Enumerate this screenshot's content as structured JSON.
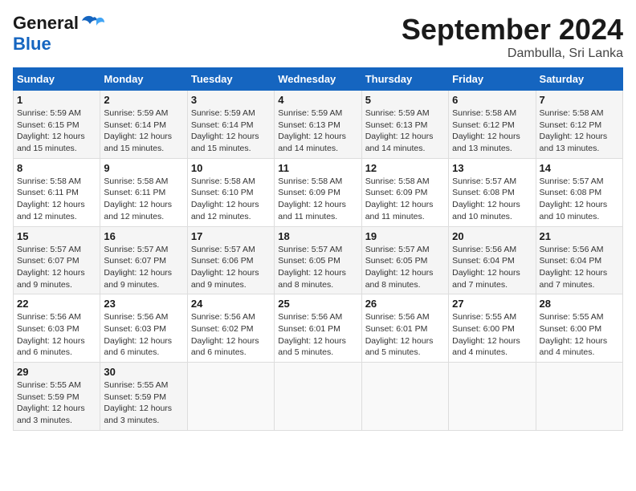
{
  "header": {
    "logo_line1": "General",
    "logo_line2": "Blue",
    "month_title": "September 2024",
    "location": "Dambulla, Sri Lanka"
  },
  "weekdays": [
    "Sunday",
    "Monday",
    "Tuesday",
    "Wednesday",
    "Thursday",
    "Friday",
    "Saturday"
  ],
  "weeks": [
    [
      {
        "day": 1,
        "sunrise": "5:59 AM",
        "sunset": "6:15 PM",
        "daylight": "12 hours and 15 minutes."
      },
      {
        "day": 2,
        "sunrise": "5:59 AM",
        "sunset": "6:14 PM",
        "daylight": "12 hours and 15 minutes."
      },
      {
        "day": 3,
        "sunrise": "5:59 AM",
        "sunset": "6:14 PM",
        "daylight": "12 hours and 15 minutes."
      },
      {
        "day": 4,
        "sunrise": "5:59 AM",
        "sunset": "6:13 PM",
        "daylight": "12 hours and 14 minutes."
      },
      {
        "day": 5,
        "sunrise": "5:59 AM",
        "sunset": "6:13 PM",
        "daylight": "12 hours and 14 minutes."
      },
      {
        "day": 6,
        "sunrise": "5:58 AM",
        "sunset": "6:12 PM",
        "daylight": "12 hours and 13 minutes."
      },
      {
        "day": 7,
        "sunrise": "5:58 AM",
        "sunset": "6:12 PM",
        "daylight": "12 hours and 13 minutes."
      }
    ],
    [
      {
        "day": 8,
        "sunrise": "5:58 AM",
        "sunset": "6:11 PM",
        "daylight": "12 hours and 12 minutes."
      },
      {
        "day": 9,
        "sunrise": "5:58 AM",
        "sunset": "6:11 PM",
        "daylight": "12 hours and 12 minutes."
      },
      {
        "day": 10,
        "sunrise": "5:58 AM",
        "sunset": "6:10 PM",
        "daylight": "12 hours and 12 minutes."
      },
      {
        "day": 11,
        "sunrise": "5:58 AM",
        "sunset": "6:09 PM",
        "daylight": "12 hours and 11 minutes."
      },
      {
        "day": 12,
        "sunrise": "5:58 AM",
        "sunset": "6:09 PM",
        "daylight": "12 hours and 11 minutes."
      },
      {
        "day": 13,
        "sunrise": "5:57 AM",
        "sunset": "6:08 PM",
        "daylight": "12 hours and 10 minutes."
      },
      {
        "day": 14,
        "sunrise": "5:57 AM",
        "sunset": "6:08 PM",
        "daylight": "12 hours and 10 minutes."
      }
    ],
    [
      {
        "day": 15,
        "sunrise": "5:57 AM",
        "sunset": "6:07 PM",
        "daylight": "12 hours and 9 minutes."
      },
      {
        "day": 16,
        "sunrise": "5:57 AM",
        "sunset": "6:07 PM",
        "daylight": "12 hours and 9 minutes."
      },
      {
        "day": 17,
        "sunrise": "5:57 AM",
        "sunset": "6:06 PM",
        "daylight": "12 hours and 9 minutes."
      },
      {
        "day": 18,
        "sunrise": "5:57 AM",
        "sunset": "6:05 PM",
        "daylight": "12 hours and 8 minutes."
      },
      {
        "day": 19,
        "sunrise": "5:57 AM",
        "sunset": "6:05 PM",
        "daylight": "12 hours and 8 minutes."
      },
      {
        "day": 20,
        "sunrise": "5:56 AM",
        "sunset": "6:04 PM",
        "daylight": "12 hours and 7 minutes."
      },
      {
        "day": 21,
        "sunrise": "5:56 AM",
        "sunset": "6:04 PM",
        "daylight": "12 hours and 7 minutes."
      }
    ],
    [
      {
        "day": 22,
        "sunrise": "5:56 AM",
        "sunset": "6:03 PM",
        "daylight": "12 hours and 6 minutes."
      },
      {
        "day": 23,
        "sunrise": "5:56 AM",
        "sunset": "6:03 PM",
        "daylight": "12 hours and 6 minutes."
      },
      {
        "day": 24,
        "sunrise": "5:56 AM",
        "sunset": "6:02 PM",
        "daylight": "12 hours and 6 minutes."
      },
      {
        "day": 25,
        "sunrise": "5:56 AM",
        "sunset": "6:01 PM",
        "daylight": "12 hours and 5 minutes."
      },
      {
        "day": 26,
        "sunrise": "5:56 AM",
        "sunset": "6:01 PM",
        "daylight": "12 hours and 5 minutes."
      },
      {
        "day": 27,
        "sunrise": "5:55 AM",
        "sunset": "6:00 PM",
        "daylight": "12 hours and 4 minutes."
      },
      {
        "day": 28,
        "sunrise": "5:55 AM",
        "sunset": "6:00 PM",
        "daylight": "12 hours and 4 minutes."
      }
    ],
    [
      {
        "day": 29,
        "sunrise": "5:55 AM",
        "sunset": "5:59 PM",
        "daylight": "12 hours and 3 minutes."
      },
      {
        "day": 30,
        "sunrise": "5:55 AM",
        "sunset": "5:59 PM",
        "daylight": "12 hours and 3 minutes."
      },
      null,
      null,
      null,
      null,
      null
    ]
  ]
}
